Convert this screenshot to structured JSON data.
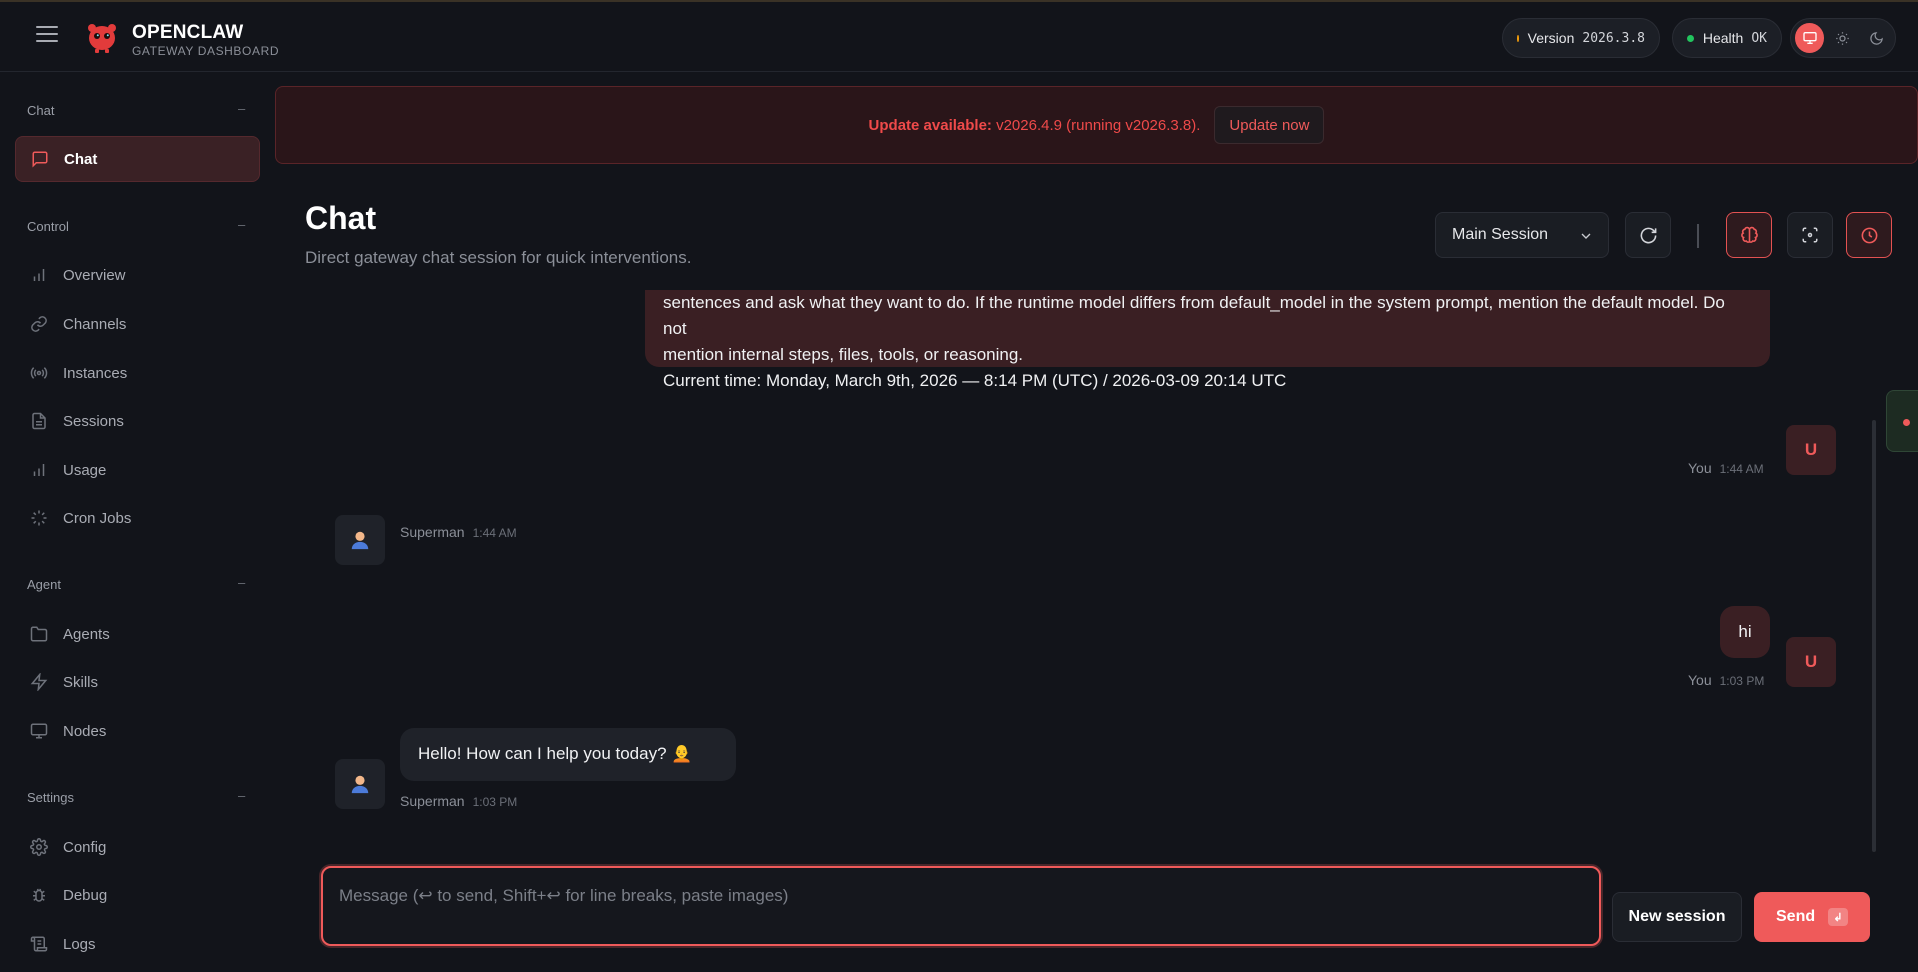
{
  "header": {
    "brand_title": "OPENCLAW",
    "brand_subtitle": "GATEWAY DASHBOARD",
    "version_label": "Version",
    "version_value": "2026.3.8",
    "health_label": "Health",
    "health_value": "OK",
    "colors": {
      "version_dot": "#f59e0b",
      "health_dot": "#22c55e",
      "accent": "#ef5a5a"
    }
  },
  "sidebar": {
    "sections": [
      {
        "title": "Chat",
        "collapse": "–",
        "items": [
          {
            "label": "Chat",
            "icon": "message-square-icon",
            "active": true
          }
        ]
      },
      {
        "title": "Control",
        "collapse": "–",
        "items": [
          {
            "label": "Overview",
            "icon": "bar-chart-icon"
          },
          {
            "label": "Channels",
            "icon": "link-icon"
          },
          {
            "label": "Instances",
            "icon": "radio-icon"
          },
          {
            "label": "Sessions",
            "icon": "file-text-icon"
          },
          {
            "label": "Usage",
            "icon": "bar-chart-icon"
          },
          {
            "label": "Cron Jobs",
            "icon": "loader-icon"
          }
        ]
      },
      {
        "title": "Agent",
        "collapse": "–",
        "items": [
          {
            "label": "Agents",
            "icon": "folder-icon"
          },
          {
            "label": "Skills",
            "icon": "zap-icon"
          },
          {
            "label": "Nodes",
            "icon": "monitor-icon"
          }
        ]
      },
      {
        "title": "Settings",
        "collapse": "–",
        "items": [
          {
            "label": "Config",
            "icon": "settings-icon"
          },
          {
            "label": "Debug",
            "icon": "bug-icon"
          },
          {
            "label": "Logs",
            "icon": "scroll-icon"
          }
        ]
      }
    ]
  },
  "banner": {
    "prefix": "Update available:",
    "text": " v2026.4.9 (running v2026.3.8).",
    "button": "Update now"
  },
  "page": {
    "title": "Chat",
    "subtitle": "Direct gateway chat session for quick interventions.",
    "session_select": "Main Session"
  },
  "messages": [
    {
      "role": "user",
      "lines": [
        "sentences and ask what they want to do. If the runtime model differs from default_model in the system prompt, mention the default model. Do not",
        "mention internal steps, files, tools, or reasoning.",
        "Current time: Monday, March 9th, 2026 — 8:14 PM (UTC) / 2026-03-09 20:14 UTC"
      ],
      "author": "You",
      "time": "1:44 AM",
      "avatar": "U"
    },
    {
      "role": "assistant",
      "text": "",
      "author": "Superman",
      "time": "1:44 AM"
    },
    {
      "role": "user",
      "text": "hi",
      "author": "You",
      "time": "1:03 PM",
      "avatar": "U"
    },
    {
      "role": "assistant",
      "text": "Hello! How can I help you today? 🧑‍🦲",
      "author": "Superman",
      "time": "1:03 PM"
    }
  ],
  "composer": {
    "placeholder": "Message (↩ to send, Shift+↩ for line breaks, paste images)",
    "new_session": "New session",
    "send": "Send",
    "send_key": "↲"
  }
}
